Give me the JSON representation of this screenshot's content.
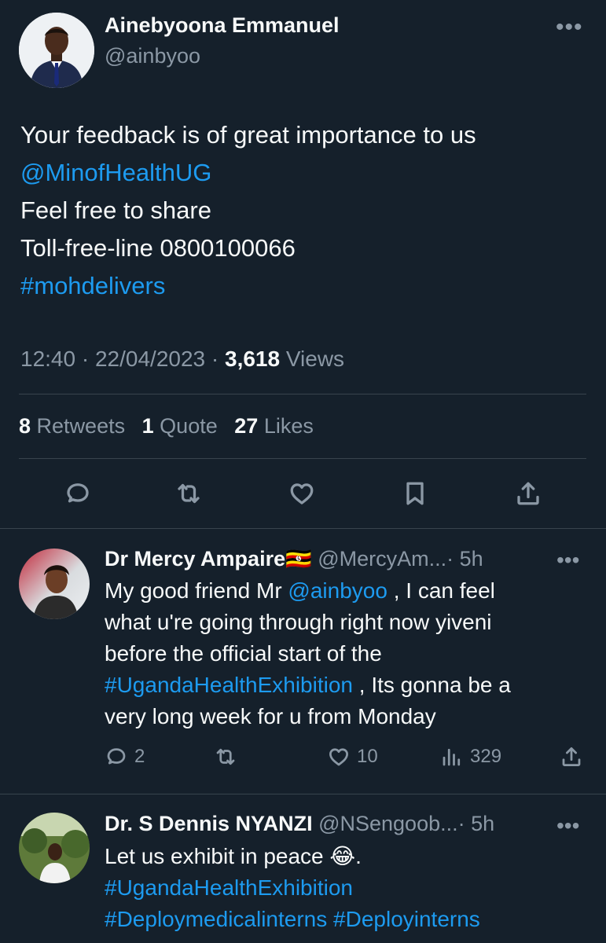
{
  "main_tweet": {
    "author_name": "Ainebyoona Emmanuel",
    "author_handle": "@ainbyoo",
    "more_label": "•••",
    "lines": [
      {
        "text": "Your feedback  is of great importance  to us",
        "type": "text"
      },
      {
        "text": "@MinofHealthUG",
        "type": "link"
      },
      {
        "text": "Feel free to share",
        "type": "text"
      },
      {
        "text": "Toll-free-line 0800100066",
        "type": "text"
      },
      {
        "text": "#mohdelivers",
        "type": "link"
      }
    ],
    "time": "12:40",
    "dot": "·",
    "date": "22/04/2023",
    "views_count": "3,618",
    "views_label": "Views",
    "retweets_count": "8",
    "retweets_label": "Retweets",
    "quotes_count": "1",
    "quotes_label": "Quote",
    "likes_count": "27",
    "likes_label": "Likes"
  },
  "replies": [
    {
      "name": "Dr Mercy Ampaire",
      "flag": "🇺🇬",
      "handle": "@MercyAm...",
      "time": "· 5h",
      "more": "•••",
      "line1_prefix": "My good friend Mr ",
      "line1_mention": "@ainbyoo",
      "line1_suffix": " , I can feel",
      "line2": "what u're going through right now yiveni",
      "line3": "before the official start of the",
      "line4_hashtag": "#UgandaHealthExhibition",
      "line4_suffix": " , Its gonna be a",
      "line5": "very long week for u from Monday",
      "reply_count": "2",
      "like_count": "10",
      "view_count": "329"
    },
    {
      "name": "Dr. S Dennis NYANZI",
      "handle": "@NSengoob...",
      "time": "· 5h",
      "more": "•••",
      "line1": "Let us exhibit in peace ",
      "emoji": "😂",
      "line1_end": ".",
      "line2": "#UgandaHealthExhibition",
      "line3": "#Deploymedicalinterns #Deployinterns"
    }
  ],
  "colors": {
    "background": "#15202b",
    "text": "#f7f9f9",
    "muted": "#8b98a5",
    "link": "#1d9bf0",
    "divider": "#38444d"
  },
  "icons": [
    "reply-icon",
    "retweet-icon",
    "like-icon",
    "bookmark-icon",
    "share-icon",
    "views-icon"
  ]
}
